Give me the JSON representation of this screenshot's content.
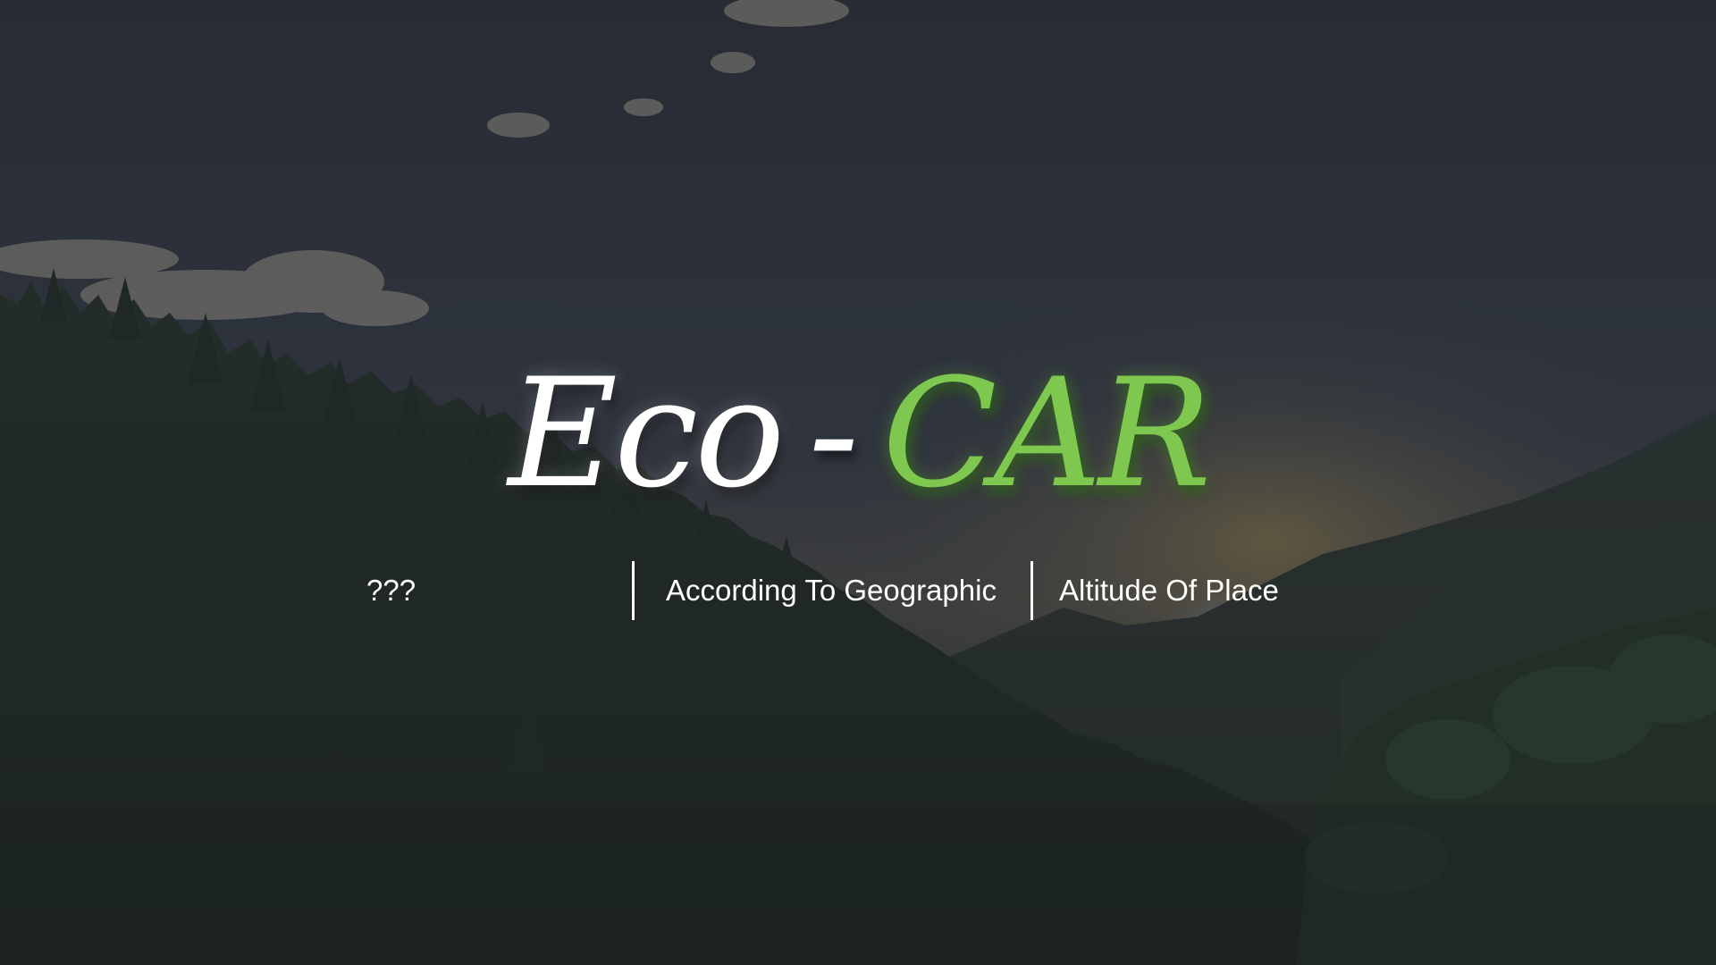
{
  "hero": {
    "title_part1": "Eco",
    "title_dash": "-",
    "title_part2": "CAR",
    "accent_color": "#7ec850",
    "tagline": [
      {
        "text": "???"
      },
      {
        "text": "According To Geographic"
      },
      {
        "text": "Altitude Of Place"
      }
    ]
  },
  "background": {
    "scene": "forest-mountain-dusk"
  }
}
